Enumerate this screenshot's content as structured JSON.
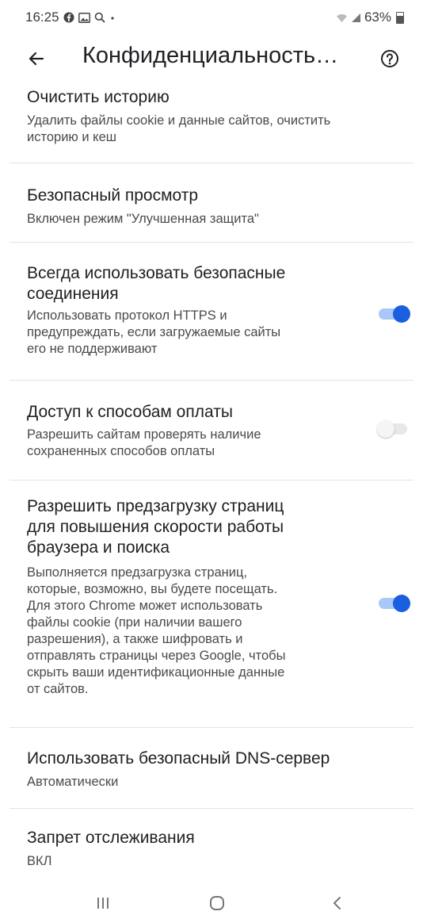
{
  "status_bar": {
    "time": "16:25",
    "left_icons": [
      "facebook-icon",
      "gallery-icon",
      "search-icon",
      "dot-icon"
    ],
    "battery": "63%"
  },
  "toolbar": {
    "title": "Конфиденциальность…"
  },
  "settings": [
    {
      "title": "Очистить историю",
      "description_lines": [
        "Удалить файлы cookie и данные сайтов, очистить",
        "историю и кеш"
      ]
    },
    {
      "title": "Безопасный просмотр",
      "description_lines": [
        "Включен режим \"Улучшенная защита\""
      ]
    },
    {
      "title_lines": [
        "Всегда использовать безопасные",
        "соединения"
      ],
      "description_lines": [
        "Использовать протокол HTTPS и",
        "предупреждать, если загружаемые сайты",
        "его не поддерживают"
      ],
      "toggle": true
    },
    {
      "title": "Доступ к способам оплаты",
      "description_lines": [
        "Разрешить сайтам проверять наличие",
        "сохраненных способов оплаты"
      ],
      "toggle": false
    },
    {
      "title_lines": [
        "Разрешить предзагрузку страниц",
        "для повышения скорости работы",
        "браузера и поиска"
      ],
      "description_lines": [
        "Выполняется предзагрузка страниц,",
        "которые, возможно, вы будете посещать.",
        "Для этого Chrome может использовать",
        "файлы cookie (при наличии вашего",
        "разрешения), а также шифровать и",
        "отправлять страницы через Google, чтобы",
        "скрыть ваши идентификационные данные",
        "от сайтов."
      ],
      "toggle": true
    },
    {
      "title": "Использовать безопасный DNS-сервер",
      "description_lines": [
        "Автоматически"
      ]
    },
    {
      "title": "Запрет отслеживания",
      "description_lines": [
        "ВКЛ"
      ]
    }
  ],
  "colors": {
    "accent": "#1a5fe0",
    "accent_track": "#a8c7fa",
    "divider": "#e3e3e3"
  }
}
